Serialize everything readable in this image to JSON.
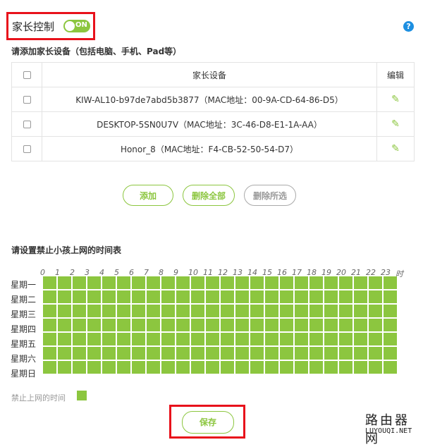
{
  "parental_control": {
    "title": "家长控制",
    "toggle_label": "ON",
    "help_icon": "?"
  },
  "devices_section": {
    "title": "请添加家长设备（包括电脑、手机、Pad等）",
    "col_device": "家长设备",
    "col_edit": "编辑",
    "rows": [
      {
        "device": "KIW-AL10-b97de7abd5b3877（MAC地址：00-9A-CD-64-86-D5）"
      },
      {
        "device": "DESKTOP-5SN0U7V（MAC地址：3C-46-D8-E1-1A-AA）"
      },
      {
        "device": "Honor_8（MAC地址：F4-CB-52-50-54-D7）"
      }
    ]
  },
  "buttons": {
    "add": "添加",
    "delete_all": "删除全部",
    "delete_selected": "删除所选",
    "save": "保存"
  },
  "schedule": {
    "title": "请设置禁止小孩上网的时间表",
    "hours": [
      "0",
      "1",
      "2",
      "3",
      "4",
      "5",
      "6",
      "7",
      "8",
      "9",
      "10",
      "11",
      "12",
      "13",
      "14",
      "15",
      "16",
      "17",
      "18",
      "19",
      "20",
      "21",
      "22",
      "23"
    ],
    "hour_unit": "时",
    "days": [
      "星期一",
      "星期二",
      "星期三",
      "星期四",
      "星期五",
      "星期六",
      "星期日"
    ],
    "legend": "禁止上网的时间"
  },
  "watermark": {
    "line1": "路由器网",
    "line2": "LUYOUQI.NET"
  },
  "colors": {
    "accent": "#8cc63f",
    "highlight_border": "#e8111b",
    "help": "#1d8fe1"
  }
}
